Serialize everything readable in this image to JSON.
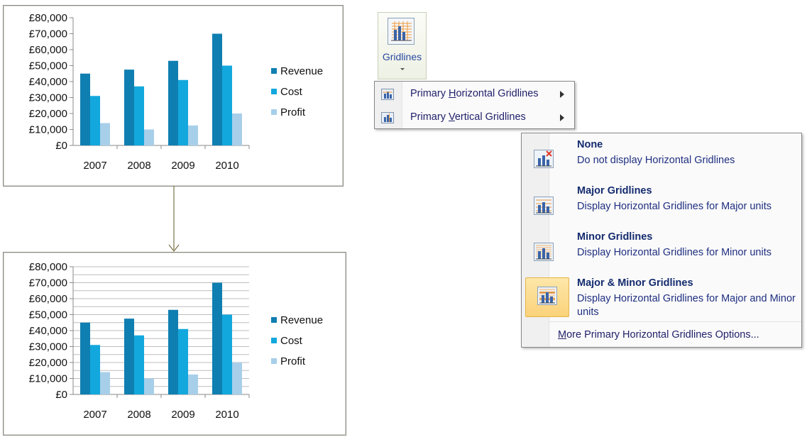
{
  "chart_data": [
    {
      "type": "bar",
      "gridlines": "none",
      "categories": [
        "2007",
        "2008",
        "2009",
        "2010"
      ],
      "series": [
        {
          "name": "Revenue",
          "color": "#0f7fb1",
          "values": [
            45000,
            47500,
            53000,
            70000
          ]
        },
        {
          "name": "Cost",
          "color": "#13a8dd",
          "values": [
            31000,
            37000,
            41000,
            50000
          ]
        },
        {
          "name": "Profit",
          "color": "#a7cfea",
          "values": [
            14000,
            10000,
            12500,
            20000
          ]
        }
      ],
      "y_ticks": [
        "£0",
        "£10,000",
        "£20,000",
        "£30,000",
        "£40,000",
        "£50,000",
        "£60,000",
        "£70,000",
        "£80,000"
      ],
      "ylim": [
        0,
        80000
      ],
      "legend_position": "right"
    },
    {
      "type": "bar",
      "gridlines": "major-and-minor-horizontal",
      "categories": [
        "2007",
        "2008",
        "2009",
        "2010"
      ],
      "series": [
        {
          "name": "Revenue",
          "color": "#0f7fb1",
          "values": [
            45000,
            47500,
            53000,
            70000
          ]
        },
        {
          "name": "Cost",
          "color": "#13a8dd",
          "values": [
            31000,
            37000,
            41000,
            50000
          ]
        },
        {
          "name": "Profit",
          "color": "#a7cfea",
          "values": [
            14000,
            10000,
            12500,
            20000
          ]
        }
      ],
      "y_ticks": [
        "£0",
        "£10,000",
        "£20,000",
        "£30,000",
        "£40,000",
        "£50,000",
        "£60,000",
        "£70,000",
        "£80,000"
      ],
      "ylim": [
        0,
        80000
      ],
      "legend_position": "right"
    }
  ],
  "ribbon": {
    "gridlines_label": "Gridlines",
    "icon": "gridlines-icon"
  },
  "menu1": {
    "items": [
      {
        "pre": "Primary ",
        "ul": "H",
        "post": "orizontal Gridlines",
        "icon": "horizontal-gridlines-icon"
      },
      {
        "pre": "Primary ",
        "ul": "V",
        "post": "ertical Gridlines",
        "icon": "vertical-gridlines-icon"
      }
    ]
  },
  "menu2": {
    "items": [
      {
        "title": "None",
        "desc": "Do not display Horizontal Gridlines",
        "icon": "no-gridlines-icon"
      },
      {
        "title": "Major Gridlines",
        "desc": "Display Horizontal Gridlines for Major units",
        "icon": "major-gridlines-icon"
      },
      {
        "title": "Minor Gridlines",
        "desc": "Display Horizontal Gridlines for Minor units",
        "icon": "minor-gridlines-icon"
      },
      {
        "title": "Major & Minor Gridlines",
        "desc": "Display Horizontal Gridlines for Major and Minor units",
        "icon": "major-minor-gridlines-icon"
      }
    ],
    "more_ul": "M",
    "more_rest": "ore Primary Horizontal Gridlines Options..."
  }
}
